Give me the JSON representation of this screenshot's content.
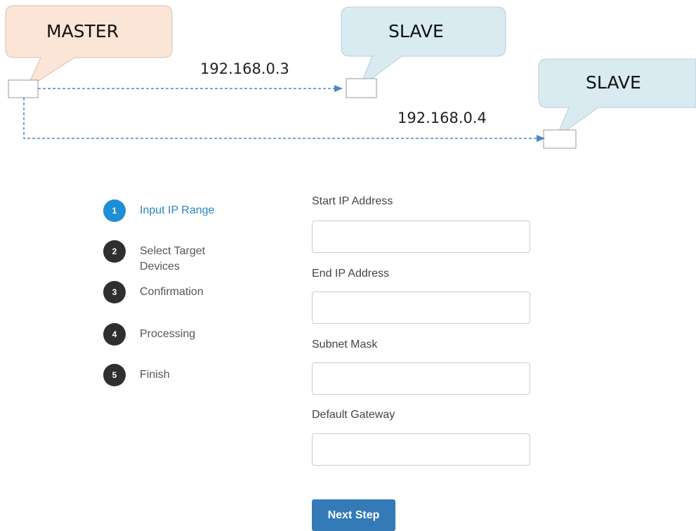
{
  "diagram": {
    "master_label": "MASTER",
    "slave1_label": "SLAVE",
    "slave2_label": "SLAVE",
    "ip1": "192.168.0.3",
    "ip2": "192.168.0.4",
    "colors": {
      "master_fill": "#fbe5d6",
      "slave_fill": "#d9eaf1",
      "arrow": "#4a86c8"
    }
  },
  "steps": [
    {
      "number": "1",
      "label": "Input IP Range",
      "active": true
    },
    {
      "number": "2",
      "label": "Select Target Devices",
      "active": false
    },
    {
      "number": "3",
      "label": "Confirmation",
      "active": false
    },
    {
      "number": "4",
      "label": "Processing",
      "active": false
    },
    {
      "number": "5",
      "label": "Finish",
      "active": false
    }
  ],
  "form": {
    "start_ip_label": "Start IP Address",
    "start_ip_value": "",
    "end_ip_label": "End IP Address",
    "end_ip_value": "",
    "subnet_label": "Subnet Mask",
    "subnet_value": "",
    "gateway_label": "Default Gateway",
    "gateway_value": ""
  },
  "next_button_label": "Next Step",
  "colors": {
    "accent": "#1e8fd5",
    "button": "#337ab7"
  }
}
